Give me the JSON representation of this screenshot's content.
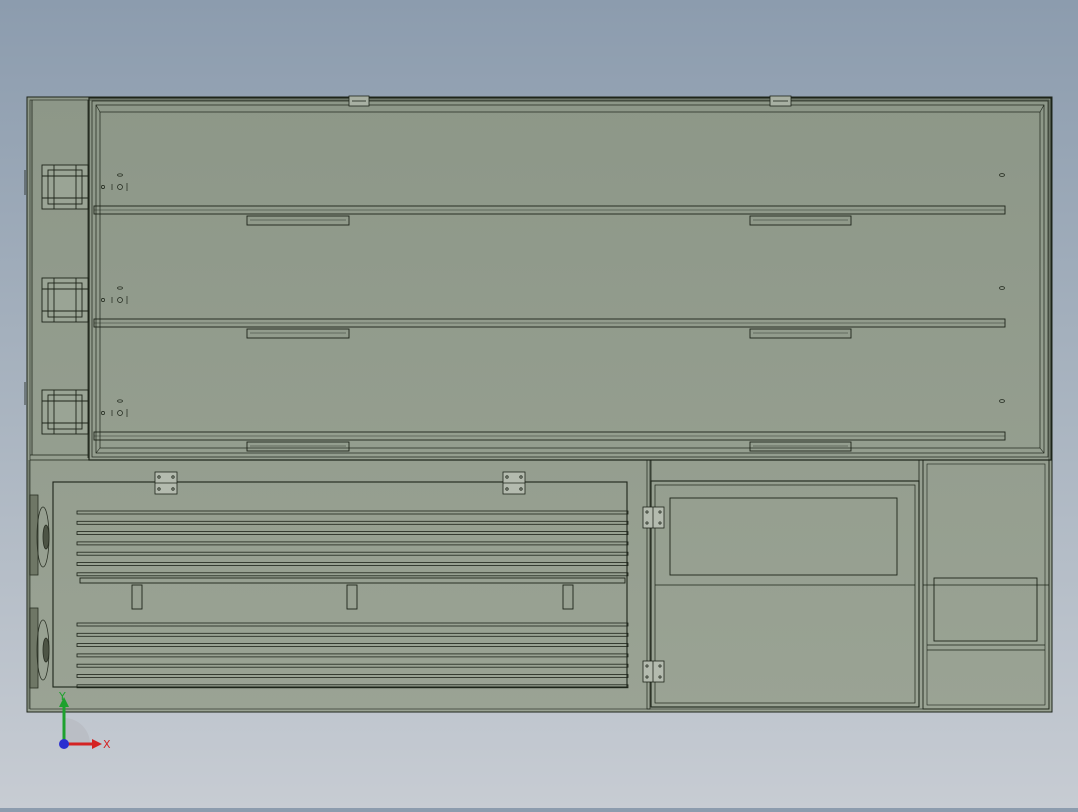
{
  "viewport": {
    "background_top": "#8c9cae",
    "background_bottom": "#c7ccd3",
    "model_fill": "#8f9a89",
    "line_color": "#1d2419"
  },
  "triad": {
    "x_label": "X",
    "y_label": "Y",
    "x_color": "#d42323",
    "y_color": "#1ea12e",
    "z_color": "#2a2fd0"
  }
}
